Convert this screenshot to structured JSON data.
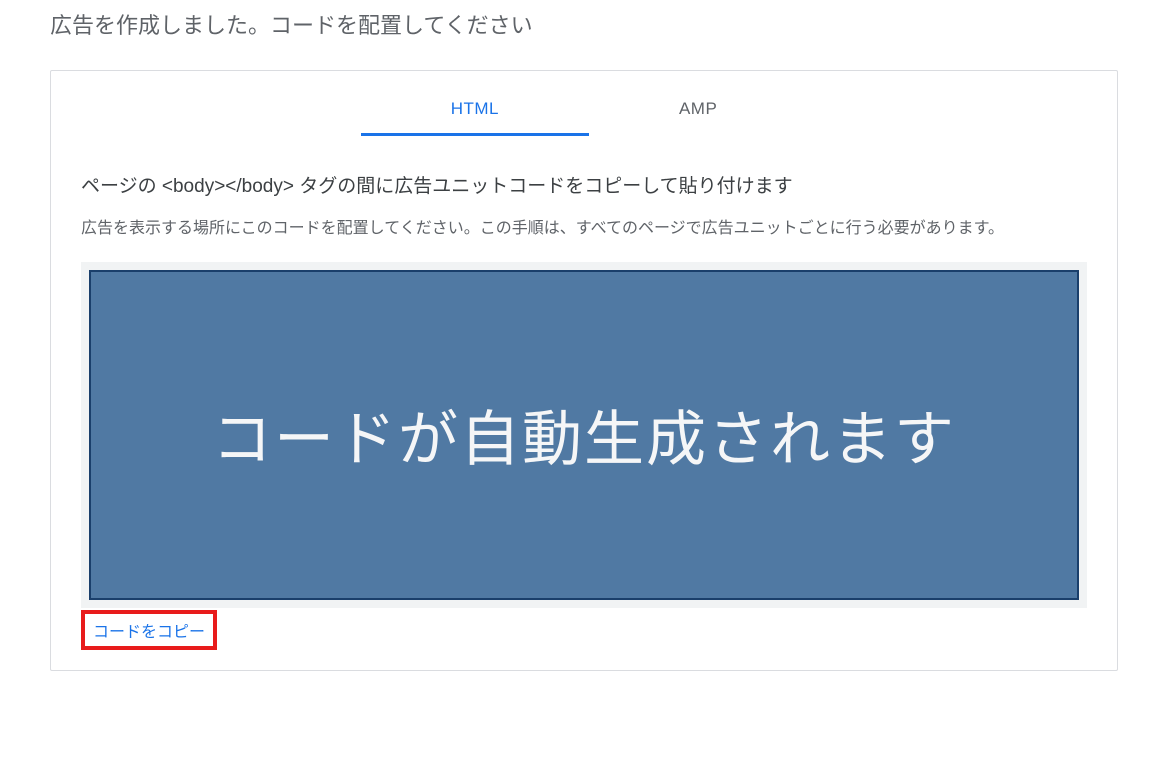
{
  "page": {
    "title": "広告を作成しました。コードを配置してください"
  },
  "tabs": {
    "html": "HTML",
    "amp": "AMP"
  },
  "instructions": {
    "title": "ページの <body></body> タグの間に広告ユニットコードをコピーして貼り付けます",
    "text": "広告を表示する場所にこのコードを配置してください。この手順は、すべてのページで広告ユニットごとに行う必要があります。"
  },
  "codeArea": {
    "placeholder": "コードが自動生成されます"
  },
  "actions": {
    "copyCode": "コードをコピー"
  }
}
